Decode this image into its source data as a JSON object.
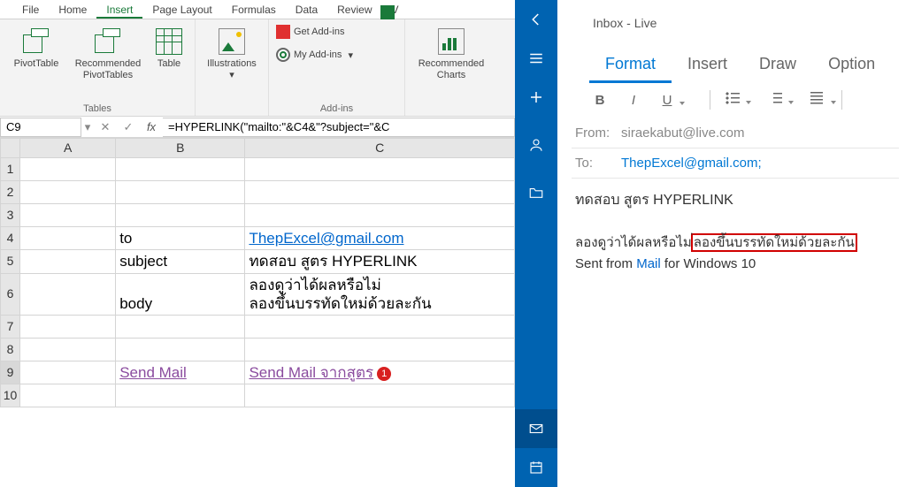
{
  "excel": {
    "tabs": [
      "File",
      "Home",
      "Insert",
      "Page Layout",
      "Formulas",
      "Data",
      "Review",
      "V"
    ],
    "active_tab": "Insert",
    "ribbon": {
      "tables_group": {
        "label": "Tables",
        "btn1": "PivotTable",
        "btn2_l1": "Recommended",
        "btn2_l2": "PivotTables",
        "btn3": "Table"
      },
      "illus_group": {
        "label": "",
        "btn": "Illustrations"
      },
      "addins_group": {
        "label": "Add-ins",
        "get": "Get Add-ins",
        "my": "My Add-ins"
      },
      "charts_group": {
        "label": "",
        "btn_l1": "Recommended",
        "btn_l2": "Charts"
      }
    },
    "namebox": "C9",
    "formula": "=HYPERLINK(\"mailto:\"&C4&\"?subject=\"&C",
    "cols": [
      "A",
      "B",
      "C"
    ],
    "rows": [
      "1",
      "2",
      "3",
      "4",
      "5",
      "6",
      "7",
      "8",
      "9",
      "10"
    ],
    "cells": {
      "B4": "to",
      "C4": "ThepExcel@gmail.com",
      "B5": "subject",
      "C5": "ทดสอบ สูตร HYPERLINK",
      "B6": "body",
      "C6_l1": "ลองดูว่าได้ผลหรือไม่",
      "C6_l2": "ลองขึ้นบรรทัดใหม่ด้วยละกัน",
      "B9": "Send Mail",
      "C9": "Send Mail จากสูตร",
      "C9_badge": "1"
    }
  },
  "mail": {
    "title": "Inbox - Live",
    "tabs": [
      "Format",
      "Insert",
      "Draw",
      "Option"
    ],
    "active_tab": "Format",
    "from_label": "From:",
    "from": "siraekabut@live.com",
    "to_label": "To:",
    "to": "ThepExcel@gmail.com;",
    "subject": "ทดสอบ สูตร HYPERLINK",
    "body_line_left": "ลองดูว่าได้ผลหรือไม",
    "body_line_box": "่ลองขึ้นบรรทัดใหม่ด้วยละกัน",
    "sent_prefix": "Sent from ",
    "sent_link": "Mail",
    "sent_suffix": " for Windows 10"
  }
}
